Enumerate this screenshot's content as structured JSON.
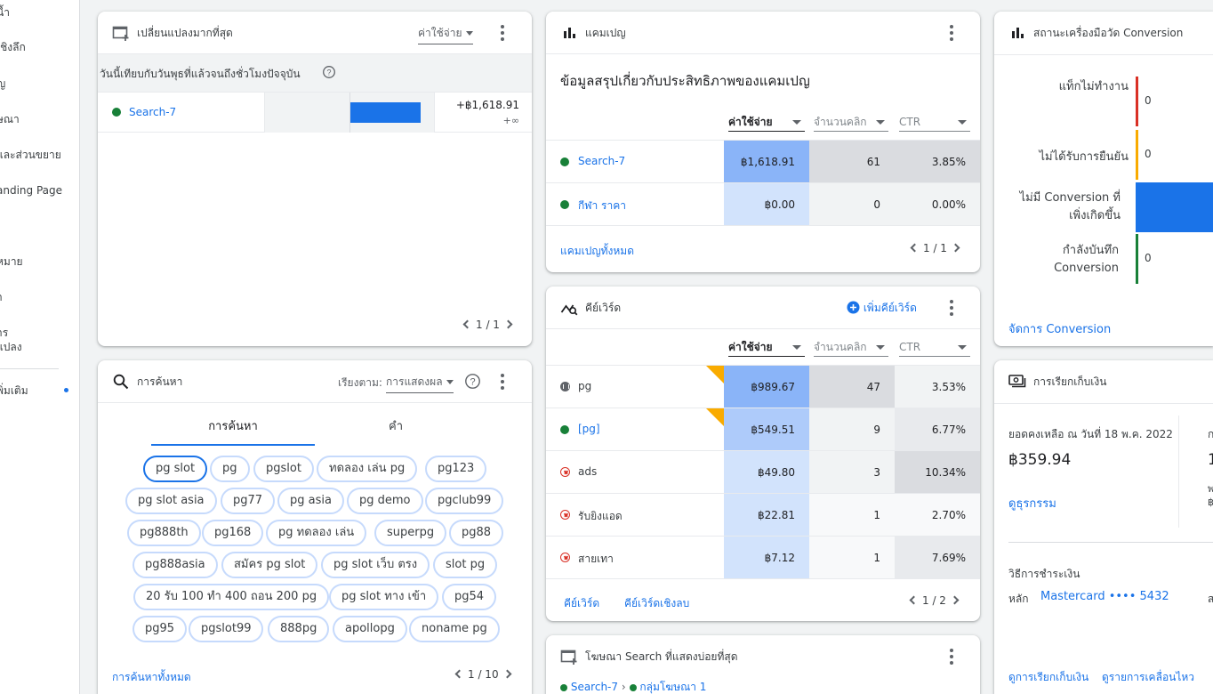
{
  "sidebar": {
    "items": [
      "น้ำ",
      "เชิงลึก",
      "ญ",
      "ษณา",
      "และส่วนขยาย",
      "anding Page",
      "หมาย",
      "ำ",
      "าร",
      "แปลง",
      "พิ่มเติม"
    ]
  },
  "changes_card": {
    "title": "เปลี่ยนแปลงมากที่สุด",
    "metric": "ค่าใช้จ่าย",
    "subtitle": "วันนี้เทียบกับวันพุธที่แล้วจนถึงชั่วโมงปัจจุบัน",
    "row": {
      "name": "Search-7",
      "value": "+฿1,618.91",
      "sub": "+∞",
      "bar_fraction": 1.0
    },
    "pager": "1 / 1"
  },
  "search_card": {
    "title": "การค้นหา",
    "sort_label": "เรียงตาม:",
    "sort_value": "การแสดงผล",
    "tabs": [
      "การค้นหา",
      "คำ"
    ],
    "chips": [
      "pg slot",
      "pg",
      "pgslot",
      "ทดลอง เล่น pg",
      "pg123",
      "pg slot asia",
      "pg77",
      "pg asia",
      "pg demo",
      "pgclub99",
      "pg888th",
      "pg168",
      "pg ทดลอง เล่น",
      "superpg",
      "pg88",
      "pg888asia",
      "สมัคร pg slot",
      "pg slot เว็บ ตรง",
      "slot pg",
      "20 รับ 100 ทํา 400 ถอน 200 pg",
      "pg slot ทาง เข้า",
      "pg54",
      "pg95",
      "pgslot99",
      "888pg",
      "apollopg",
      "noname pg"
    ],
    "link": "การค้นหาทั้งหมด",
    "pager": "1 / 10"
  },
  "campaign_card": {
    "title": "แคมเปญ",
    "heading": "ข้อมูลสรุปเกี่ยวกับประสิทธิภาพของแคมเปญ",
    "columns": [
      "ค่าใช้จ่าย",
      "จำนวนคลิก",
      "CTR"
    ],
    "rows": [
      {
        "name": "Search-7",
        "cost": "฿1,618.91",
        "clicks": "61",
        "ctr": "3.85%"
      },
      {
        "name": "กีฬา ราคา",
        "cost": "฿0.00",
        "clicks": "0",
        "ctr": "0.00%"
      }
    ],
    "link": "แคมเปญทั้งหมด",
    "pager": "1 / 1"
  },
  "keyword_card": {
    "title": "คีย์เวิร์ด",
    "add_label": "เพิ่มคีย์เวิร์ด",
    "columns": [
      "ค่าใช้จ่าย",
      "จำนวนคลิก",
      "CTR"
    ],
    "rows": [
      {
        "name": "pg",
        "status": "paused",
        "flag": true,
        "cost": "฿989.67",
        "clicks": "47",
        "ctr": "3.53%"
      },
      {
        "name": "[pg]",
        "status": "active",
        "flag": true,
        "cost": "฿549.51",
        "clicks": "9",
        "ctr": "6.77%"
      },
      {
        "name": "ads",
        "status": "removed",
        "flag": false,
        "cost": "฿49.80",
        "clicks": "3",
        "ctr": "10.34%"
      },
      {
        "name": "รับยิงแอด",
        "status": "removed",
        "flag": false,
        "cost": "฿22.81",
        "clicks": "1",
        "ctr": "2.70%"
      },
      {
        "name": "สายเทา",
        "status": "removed",
        "flag": false,
        "cost": "฿7.12",
        "clicks": "1",
        "ctr": "7.69%"
      }
    ],
    "link1": "คีย์เวิร์ด",
    "link2": "คีย์เวิร์ดเชิงลบ",
    "pager": "1 / 2"
  },
  "ads_card": {
    "title": "โฆษณา Search ที่แสดงบ่อยที่สุด",
    "crumb1": "Search-7",
    "crumb_sep": "›",
    "crumb2": "กลุ่มโฆษณา 1"
  },
  "conversion_card": {
    "title": "สถานะเครื่องมือวัด Conversion",
    "rows": [
      {
        "label": "แท็กไม่ทำงาน",
        "value": "0",
        "color": "#d93025"
      },
      {
        "label": "ไม่ได้รับการยืนยัน",
        "value": "0",
        "color": "#f9ab00"
      },
      {
        "label": "ไม่มี Conversion ที่เพิ่งเกิดขึ้น",
        "value": "",
        "color": "#1a73e8"
      },
      {
        "label": "กำลังบันทึก Conversion",
        "value": "0",
        "color": "#188038"
      }
    ],
    "link": "จัดการ Conversion"
  },
  "billing_card": {
    "title": "การเรียกเก็บเงิน",
    "balance_label": "ยอดคงเหลือ ณ วันที่ 18 พ.ค. 2022",
    "balance": "฿359.94",
    "transactions_link": "ดูธุรกรรม",
    "right_col": [
      "ก",
      "1",
      "พ",
      "฿"
    ],
    "payment_label": "วิธีการชำระเงิน",
    "primary_label": "หลัก",
    "card": "Mastercard •••• 5432",
    "right_char": "ส",
    "link1": "ดูการเรียกเก็บเงิน",
    "link2": "ดูรายการเคลื่อนไหว"
  },
  "colors": {
    "accent": "#1a73e8",
    "green": "#188038",
    "red": "#d93025",
    "yellow": "#f9ab00"
  }
}
